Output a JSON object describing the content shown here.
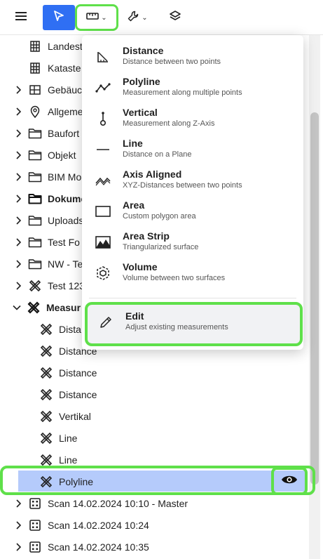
{
  "toolbar": {
    "menu_icon": "hamburger-icon",
    "select_icon": "cursor-arrow-icon",
    "measure_icon": "ruler-icon",
    "tools_icon": "wrench-icon",
    "layers_icon": "layers-icon",
    "chevron": "⌄"
  },
  "tree": {
    "rows": [
      {
        "label": "Landest",
        "icon": "grid-building-icon"
      },
      {
        "label": "Kataste",
        "icon": "grid-building-icon"
      },
      {
        "label": "Gebäuc",
        "icon": "floorplan-icon"
      },
      {
        "label": "Allgeme",
        "icon": "pin-icon"
      },
      {
        "label": "Baufort",
        "icon": "folder-icon"
      },
      {
        "label": "Objekt",
        "icon": "folder-icon"
      },
      {
        "label": "BIM Mo",
        "icon": "folder-icon"
      },
      {
        "label": "Dokume",
        "icon": "folder-icon"
      },
      {
        "label": "Uploads",
        "icon": "folder-icon"
      },
      {
        "label": "Test Fo",
        "icon": "folder-icon"
      },
      {
        "label": "NW - Te",
        "icon": "folder-icon"
      },
      {
        "label": "Test 123",
        "icon": "measure-tools-icon"
      },
      {
        "label": "Measur",
        "icon": "measure-tools-icon"
      },
      {
        "label": "Dista",
        "icon": "measure-tools-icon"
      },
      {
        "label": "Distance",
        "icon": "measure-tools-icon"
      },
      {
        "label": "Distance",
        "icon": "measure-tools-icon"
      },
      {
        "label": "Distance",
        "icon": "measure-tools-icon"
      },
      {
        "label": "Vertikal",
        "icon": "measure-tools-icon"
      },
      {
        "label": "Line",
        "icon": "measure-tools-icon"
      },
      {
        "label": "Line",
        "icon": "measure-tools-icon"
      },
      {
        "label": "Polyline",
        "icon": "measure-tools-icon"
      },
      {
        "label": "Scan 14.02.2024 10:10 - Master",
        "icon": "scan-icon"
      },
      {
        "label": "Scan 14.02.2024 10:24",
        "icon": "scan-icon"
      },
      {
        "label": "Scan 14.02.2024 10:35",
        "icon": "scan-icon"
      }
    ],
    "selected_index": 20,
    "visibility_icon": "eye-icon"
  },
  "dropdown": {
    "items": [
      {
        "title": "Distance",
        "subtitle": "Distance between two points",
        "icon": "distance-icon"
      },
      {
        "title": "Polyline",
        "subtitle": "Measurement along multiple points",
        "icon": "polyline-icon"
      },
      {
        "title": "Vertical",
        "subtitle": "Measurement along Z-Axis",
        "icon": "vertical-icon"
      },
      {
        "title": "Line",
        "subtitle": "Distance on a Plane",
        "icon": "line-icon"
      },
      {
        "title": "Axis Aligned",
        "subtitle": "XYZ-Distances between two points",
        "icon": "axis-aligned-icon"
      },
      {
        "title": "Area",
        "subtitle": "Custom polygon area",
        "icon": "area-icon"
      },
      {
        "title": "Area Strip",
        "subtitle": "Triangularized surface",
        "icon": "area-strip-icon"
      },
      {
        "title": "Volume",
        "subtitle": "Volume between two surfaces",
        "icon": "volume-icon"
      }
    ],
    "edit": {
      "title": "Edit",
      "subtitle": "Adjust existing measurements",
      "icon": "pencil-icon"
    }
  },
  "colors": {
    "accent": "#2f6ff3",
    "highlight": "#5fe04a",
    "selected_row": "#b5cbfb"
  }
}
